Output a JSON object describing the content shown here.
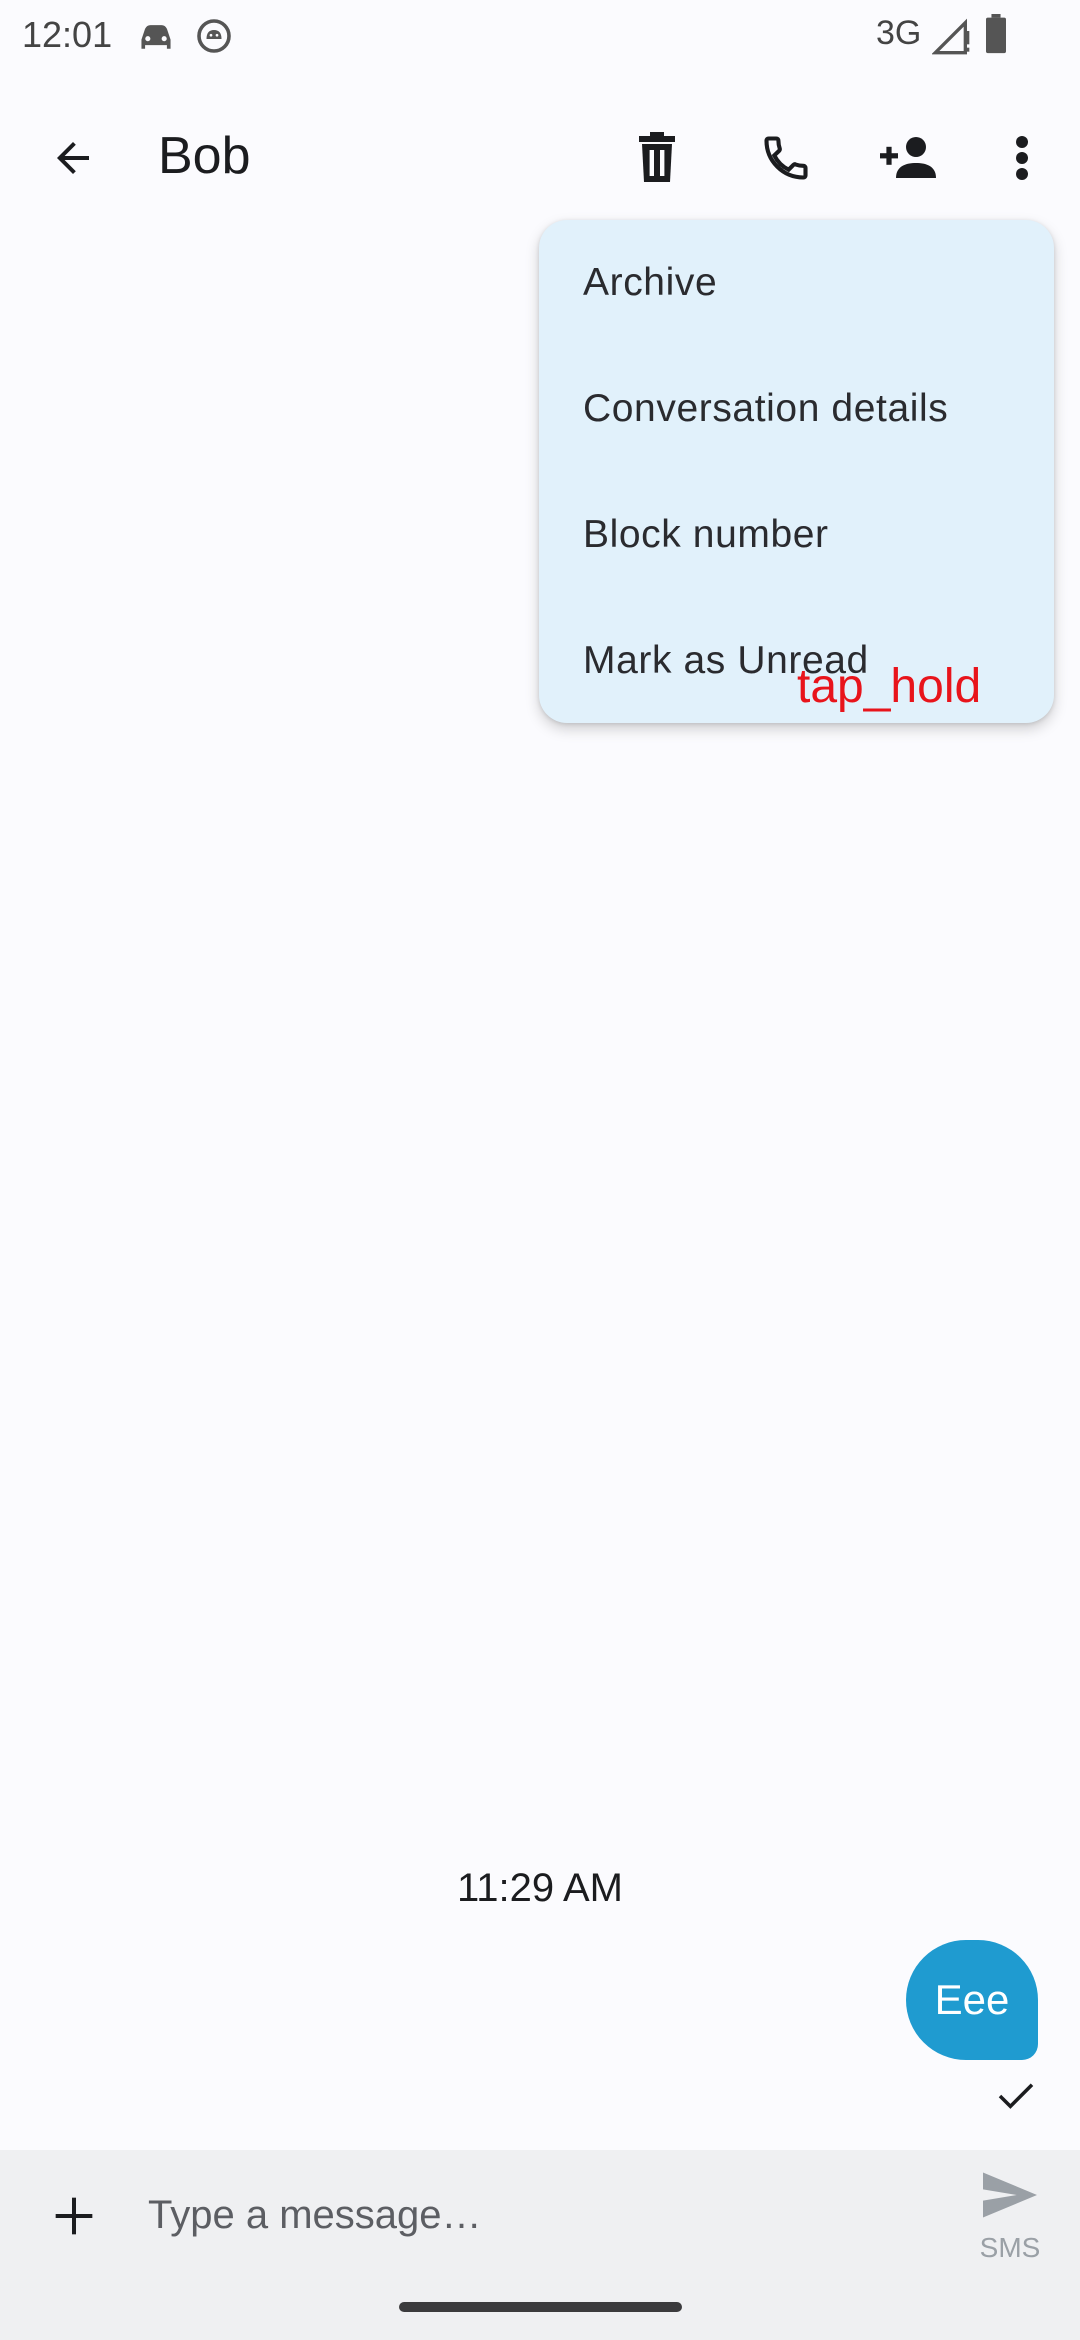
{
  "status_bar": {
    "time": "12:01",
    "network": "3G",
    "icons": [
      "car-notification-icon",
      "android-notification-icon",
      "signal-icon",
      "battery-icon"
    ]
  },
  "app_bar": {
    "title": "Bob",
    "actions": [
      "delete-icon",
      "call-icon",
      "add-contact-icon",
      "more-vert-icon"
    ]
  },
  "overflow_menu": {
    "items": [
      {
        "label": "Archive"
      },
      {
        "label": "Conversation details"
      },
      {
        "label": "Block number"
      },
      {
        "label": "Mark as Unread"
      }
    ]
  },
  "annotation": {
    "label": "tap_hold",
    "color": "#e8141b"
  },
  "conversation": {
    "timestamp": "11:29 AM",
    "messages": [
      {
        "text": "Eee",
        "direction": "outgoing",
        "status_icon": "check-icon"
      }
    ]
  },
  "composer": {
    "placeholder": "Type a message…",
    "value": "",
    "send_label": "SMS"
  },
  "colors": {
    "background": "#fbfbfe",
    "menu_background": "#e1f1fb",
    "bubble": "#1f9bd0",
    "composer_background": "#eff0f2"
  }
}
